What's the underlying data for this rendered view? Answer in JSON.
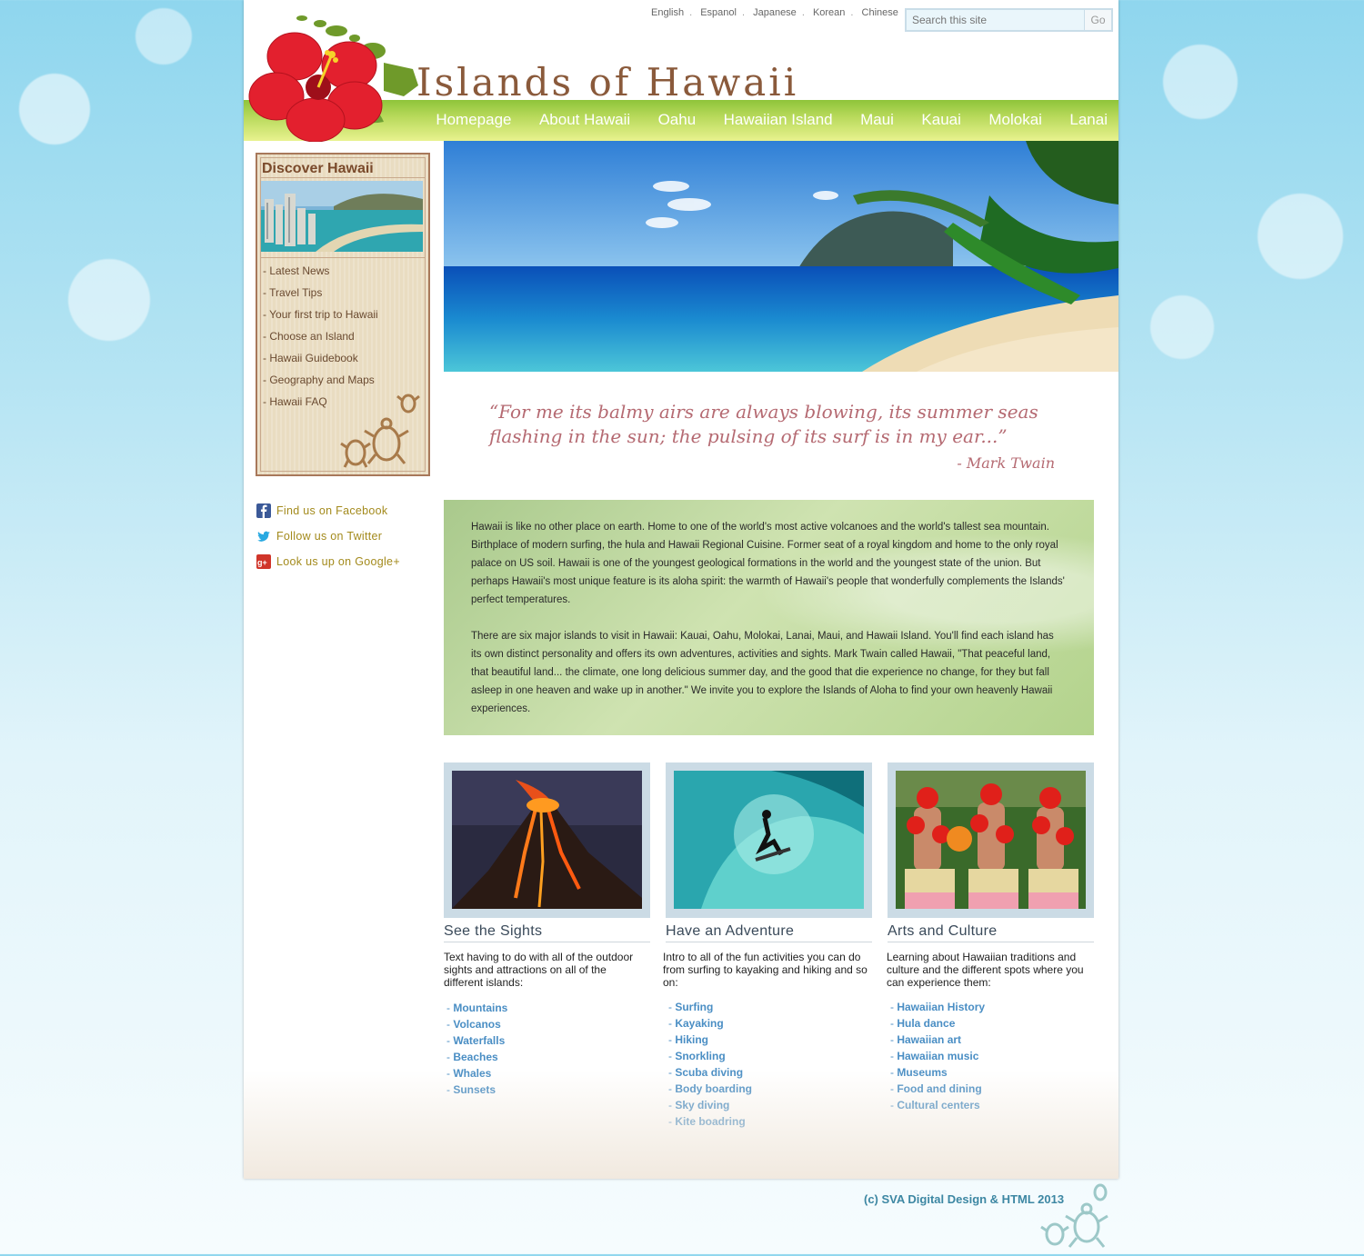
{
  "languages": [
    "English",
    "Espanol",
    "Japanese",
    "Korean",
    "Chinese"
  ],
  "search": {
    "placeholder": "Search this site",
    "button": "Go"
  },
  "site_title": "Islands of Hawaii",
  "nav": [
    "Homepage",
    "About Hawaii",
    "Oahu",
    "Hawaiian Island",
    "Maui",
    "Kauai",
    "Molokai",
    "Lanai"
  ],
  "sidebar": {
    "title": "Discover Hawaii",
    "links": [
      "- Latest News",
      "- Travel Tips",
      "- Your first trip to Hawaii",
      "- Choose an Island",
      "- Hawaii Guidebook",
      "- Geography and Maps",
      "- Hawaii FAQ"
    ]
  },
  "social": [
    {
      "icon": "facebook-icon",
      "label": "Find us on Facebook",
      "color": "#3b5998"
    },
    {
      "icon": "twitter-icon",
      "label": "Follow us on Twitter",
      "color": "#29a9e1"
    },
    {
      "icon": "google-plus-icon",
      "label": "Look us up on Google+",
      "color": "#d0352a"
    }
  ],
  "quote": {
    "text": "“For me its balmy airs are always blowing, its summer seas flashing in the sun; the pulsing of its surf is in my ear...”",
    "author": "- Mark Twain"
  },
  "intro": [
    "Hawaii is like no other place on earth. Home to one of the world's most active volcanoes and the world's tallest sea mountain. Birthplace of modern surfing, the hula and Hawaii Regional Cuisine. Former seat of a royal kingdom and home to the only royal palace on US soil. Hawaii is one of the youngest geological formations in the world and the youngest state of the union. But perhaps Hawaii's most unique feature is its aloha spirit: the warmth of Hawaii's people that wonderfully complements the Islands' perfect temperatures.",
    "There are six major islands to visit in Hawaii: Kauai, Oahu, Molokai, Lanai, Maui, and Hawaii Island. You'll find each island has its own distinct personality and offers its own adventures, activities and sights. Mark Twain called Hawaii, \"That peaceful land, that beautiful land... the climate, one long delicious summer day, and the good that die experience no change, for they but fall asleep in one heaven and wake up in another.\" We invite you to explore the Islands of Aloha to find your own heavenly Hawaii experiences."
  ],
  "cards": [
    {
      "title": "See the Sights",
      "desc": "Text having to do with all of the outdoor sights and attractions on all of the different islands:",
      "links": [
        "Mountains",
        "Volcanos",
        "Waterfalls",
        "Beaches",
        "Whales",
        "Sunsets"
      ]
    },
    {
      "title": "Have an Adventure",
      "desc": "Intro to all of the fun activities you can do from surfing to kayaking and hiking and so on:",
      "links": [
        "Surfing",
        "Kayaking",
        "Hiking",
        "Snorkling",
        "Scuba diving",
        "Body boarding",
        "Sky diving",
        "Kite boadring"
      ]
    },
    {
      "title": "Arts and Culture",
      "desc": "Learning about Hawaiian traditions and culture and the different spots where you can experience them:",
      "links": [
        "Hawaiian History",
        "Hula dance",
        "Hawaiian art",
        "Hawaiian music",
        "Museums",
        "Food and dining",
        "Cultural centers"
      ]
    }
  ],
  "footer": "(c) SVA Digital Design & HTML 2013"
}
